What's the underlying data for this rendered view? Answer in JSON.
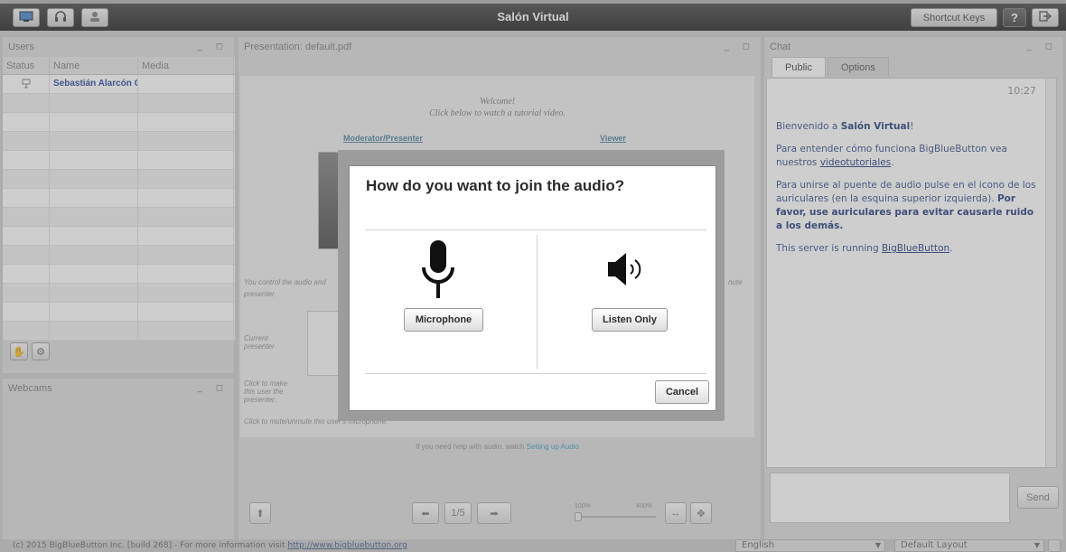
{
  "app": {
    "title": "Salón Virtual",
    "shortcut_keys_label": "Shortcut Keys",
    "help_label": "?"
  },
  "users": {
    "panel_title": "Users",
    "columns": [
      "Status",
      "Name",
      "Media"
    ],
    "rows": [
      {
        "status_icon": "presenter-icon",
        "name": "Sebastián Alarcón C",
        "media": ""
      }
    ]
  },
  "webcams": {
    "panel_title": "Webcams"
  },
  "presentation": {
    "panel_title": "Presentation: default.pdf",
    "slide": {
      "welcome_line1": "Welcome!",
      "welcome_line2": "Click below to watch a tutorial video.",
      "moderator_link": "Moderator/Presenter",
      "viewer_link": "Viewer",
      "control_text": "You control the audio and",
      "presenter_text": "presenter.",
      "mute_text": "nute",
      "current_presenter": "Current presenter",
      "click_to_make": "Click to make this user the presenter.",
      "click_to_mute": "Click to mute/unmute this user's microphone.",
      "help_text": "If you need help with audio, watch",
      "help_link": "Setting up Audio"
    },
    "page_indicator": "1/5",
    "zoom_min": "100%",
    "zoom_max": "400%"
  },
  "chat": {
    "panel_title": "Chat",
    "tabs": [
      "Public",
      "Options"
    ],
    "time": "10:27",
    "welcome_prefix": "Bienvenido a ",
    "welcome_room": "Salón Virtual",
    "welcome_suffix": "!",
    "tutorial_text": "Para entender cómo funciona BigBlueButton vea nuestros ",
    "tutorial_link": "videotutoriales",
    "tutorial_end": ".",
    "audio_text": "Para unirse al puente de audio pulse en el icono de los auriculares (en la esquina superior izquierda). ",
    "audio_bold": "Por favor, use auriculares para evitar causarle ruido a los demás.",
    "server_text": "This server is running ",
    "server_link": "BigBlueButton",
    "server_end": ".",
    "send_label": "Send"
  },
  "footer": {
    "copyright": "(c) 2015 BigBlueButton Inc. [build 268] - For more information visit ",
    "copyright_link": "http://www.bigbluebutton.org",
    "language": "English",
    "layout": "Default Layout"
  },
  "audio_dialog": {
    "title": "How do you want to join the audio?",
    "microphone_label": "Microphone",
    "listen_only_label": "Listen Only",
    "cancel_label": "Cancel"
  }
}
